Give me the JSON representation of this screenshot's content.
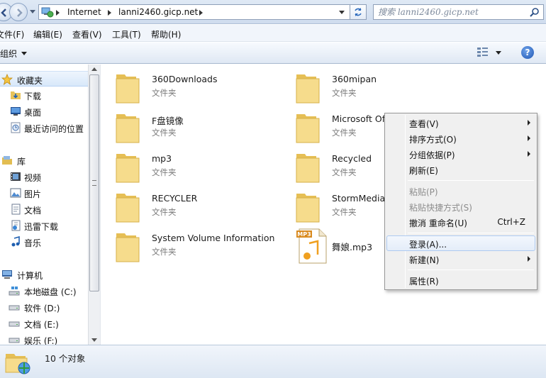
{
  "address": {
    "crumbs": [
      "Internet",
      "lanni2460.gicp.net"
    ]
  },
  "search": {
    "placeholder": "搜索 lanni2460.gicp.net"
  },
  "menubar": [
    "文件(F)",
    "编辑(E)",
    "查看(V)",
    "工具(T)",
    "帮助(H)"
  ],
  "toolbar": {
    "organize": "组织",
    "help": "?"
  },
  "nav": {
    "favorites": {
      "label": "收藏夹",
      "items": [
        "下载",
        "桌面",
        "最近访问的位置"
      ]
    },
    "libraries": {
      "label": "库",
      "items": [
        "视频",
        "图片",
        "文档",
        "迅雷下载",
        "音乐"
      ]
    },
    "computer": {
      "label": "计算机",
      "items": [
        "本地磁盘 (C:)",
        "软件 (D:)",
        "文档 (E:)",
        "娱乐 (F:)"
      ]
    }
  },
  "files": [
    {
      "name": "360Downloads",
      "type": "文件夹",
      "icon": "folder-icon"
    },
    {
      "name": "360mipan",
      "type": "文件夹",
      "icon": "folder-icon"
    },
    {
      "name": "F盘镜像",
      "type": "文件夹",
      "icon": "folder-icon"
    },
    {
      "name": "Microsoft Of",
      "type": "文件夹",
      "icon": "folder-icon"
    },
    {
      "name": "mp3",
      "type": "文件夹",
      "icon": "folder-icon"
    },
    {
      "name": "Recycled",
      "type": "文件夹",
      "icon": "folder-icon"
    },
    {
      "name": "RECYCLER",
      "type": "文件夹",
      "icon": "folder-icon"
    },
    {
      "name": "StormMedia",
      "type": "文件夹",
      "icon": "folder-icon"
    },
    {
      "name": "System Volume Information",
      "type": "文件夹",
      "icon": "folder-icon"
    },
    {
      "name": "舞娘.mp3",
      "type": "",
      "icon": "mp3-file-icon",
      "badge": "MP3"
    }
  ],
  "context_menu": {
    "items": [
      {
        "label": "查看(V)",
        "submenu": true
      },
      {
        "label": "排序方式(O)",
        "submenu": true
      },
      {
        "label": "分组依据(P)",
        "submenu": true
      },
      {
        "label": "刷新(E)"
      },
      {
        "label": "粘贴(P)",
        "disabled": true
      },
      {
        "label": "粘贴快捷方式(S)",
        "disabled": true
      },
      {
        "label": "撤消 重命名(U)",
        "shortcut": "Ctrl+Z"
      },
      {
        "label": "登录(A)...",
        "highlighted": true
      },
      {
        "label": "新建(N)",
        "submenu": true
      },
      {
        "label": "属性(R)"
      }
    ]
  },
  "status": {
    "count": "10 个对象"
  },
  "colors": {
    "accent": "#1f56b3",
    "folder": "#f2d27a",
    "menu_highlight": "#aecaf0"
  }
}
